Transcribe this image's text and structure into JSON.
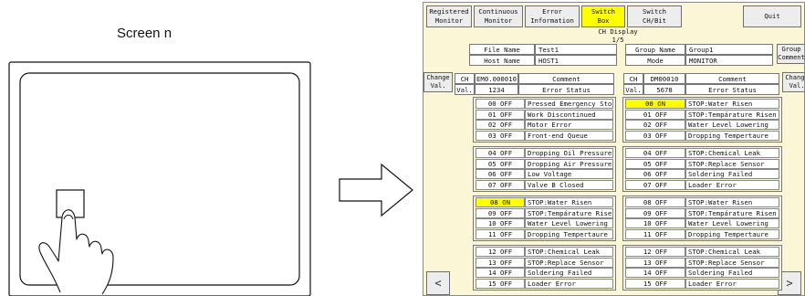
{
  "illustration": {
    "screen_label": "Screen n"
  },
  "toolbar": {
    "buttons": [
      {
        "label": "Registered\nMonitor",
        "active": false
      },
      {
        "label": "Continuous\nMonitor",
        "active": false
      },
      {
        "label": "Error\nInformation",
        "active": false
      },
      {
        "label": "Switch\nBox",
        "active": true
      },
      {
        "label": "Switch\nCH/Bit",
        "active": false
      }
    ],
    "quit_label": "Quit"
  },
  "ch_display": {
    "title": "CH Display",
    "page": "1/5"
  },
  "info": {
    "file_name_label": "File Name",
    "file_name_value": "Test1",
    "host_name_label": "Host Name",
    "host_name_value": "HOST1",
    "group_name_label": "Group Name",
    "group_name_value": "Group1",
    "mode_label": "Mode",
    "mode_value": "MONITOR"
  },
  "side_buttons": {
    "change_val_left": "Change\nVal.",
    "change_val_right": "Change\nVal.",
    "group_comment": "Group\nComment"
  },
  "left_header": {
    "ch_label": "CH",
    "ch_value": "EM0.000010",
    "comment_label": "Comment",
    "val_label": "Val.",
    "val_value": "1234",
    "status_label": "Error Status"
  },
  "right_header": {
    "ch_label": "CH",
    "ch_value": "DM00010",
    "comment_label": "Comment",
    "val_label": "Val.",
    "val_value": "5678",
    "status_label": "Error Status"
  },
  "left_rows": [
    {
      "status": "00 OFF",
      "comment": "Pressed Emergency Stop",
      "on": false
    },
    {
      "status": "01 OFF",
      "comment": "Work Discontinued",
      "on": false
    },
    {
      "status": "02 OFF",
      "comment": "Motor Error",
      "on": false
    },
    {
      "status": "03 OFF",
      "comment": "Front-end Queue",
      "on": false
    },
    {
      "status": "04 OFF",
      "comment": "Dropping Oil Pressure",
      "on": false
    },
    {
      "status": "05 OFF",
      "comment": "Dropping Air Pressure",
      "on": false
    },
    {
      "status": "06 OFF",
      "comment": "Low Voltage",
      "on": false
    },
    {
      "status": "07 OFF",
      "comment": "Valve B Closed",
      "on": false
    },
    {
      "status": "08 ON",
      "comment": "STOP:Water Risen",
      "on": true
    },
    {
      "status": "09 OFF",
      "comment": "STOP:Tempárature Risen",
      "on": false
    },
    {
      "status": "10 OFF",
      "comment": "Water Level Lowering",
      "on": false
    },
    {
      "status": "11 OFF",
      "comment": "Dropping Tempertaure",
      "on": false
    },
    {
      "status": "12 OFF",
      "comment": "STOP:Chemical Leak",
      "on": false
    },
    {
      "status": "13 OFF",
      "comment": "STOP:Replace Sensor",
      "on": false
    },
    {
      "status": "14 OFF",
      "comment": "Soldering Failed",
      "on": false
    },
    {
      "status": "15 OFF",
      "comment": "Loader Error",
      "on": false
    }
  ],
  "right_rows": [
    {
      "status": "00 ON",
      "comment": "STOP:Water Risen",
      "on": true
    },
    {
      "status": "01 OFF",
      "comment": "STOP:Tempárature Risen",
      "on": false
    },
    {
      "status": "02 OFF",
      "comment": "Water Level Lowering",
      "on": false
    },
    {
      "status": "03 OFF",
      "comment": "Dropping Tempertaure",
      "on": false
    },
    {
      "status": "04 OFF",
      "comment": "STOP:Chemical Leak",
      "on": false
    },
    {
      "status": "05 OFF",
      "comment": "STOP:Replace Sensor",
      "on": false
    },
    {
      "status": "06 OFF",
      "comment": "Soldering Failed",
      "on": false
    },
    {
      "status": "07 OFF",
      "comment": "Loader Error",
      "on": false
    },
    {
      "status": "08 OFF",
      "comment": "STOP:Water Risen",
      "on": false
    },
    {
      "status": "09 OFF",
      "comment": "STOP:Tempárature Risen",
      "on": false
    },
    {
      "status": "10 OFF",
      "comment": "Water Level Lowering",
      "on": false
    },
    {
      "status": "11 OFF",
      "comment": "Dropping Tempertaure",
      "on": false
    },
    {
      "status": "12 OFF",
      "comment": "STOP:Chemical Leak",
      "on": false
    },
    {
      "status": "13 OFF",
      "comment": "STOP:Replace Sensor",
      "on": false
    },
    {
      "status": "14 OFF",
      "comment": "Soldering Failed",
      "on": false
    },
    {
      "status": "15 OFF",
      "comment": "Loader Error",
      "on": false
    }
  ],
  "nav": {
    "prev_icon": "chevron-left-icon",
    "next_icon": "chevron-right-icon",
    "prev_glyph": "<",
    "next_glyph": ">"
  },
  "colors": {
    "panel_bg": "#fbf7d6",
    "highlight": "#ffff00"
  }
}
